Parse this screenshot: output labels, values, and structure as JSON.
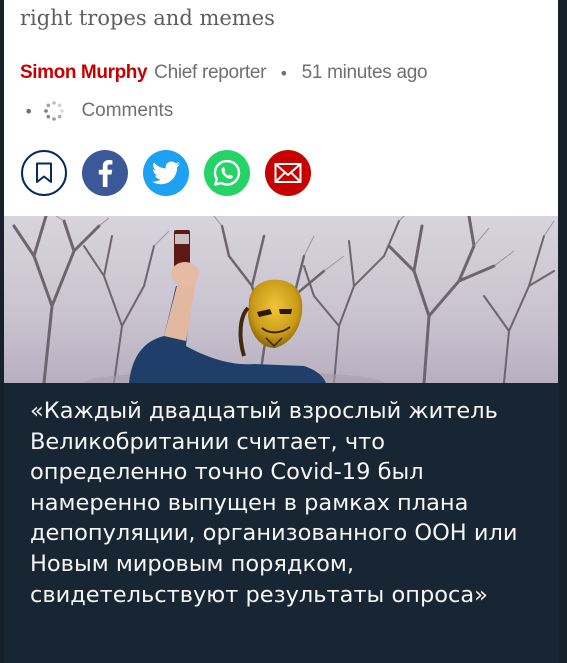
{
  "article": {
    "headline_tail": "right tropes and memes",
    "author": "Simon Murphy",
    "role": "Chief reporter",
    "time": "51 minutes ago",
    "comments_label": "Comments"
  },
  "share_icons": [
    "bookmark-icon",
    "facebook-icon",
    "twitter-icon",
    "whatsapp-icon",
    "email-icon"
  ],
  "colors": {
    "brand_red": "#c70000",
    "facebook": "#3b5998",
    "twitter": "#1da1f2",
    "whatsapp": "#25d366",
    "bookmark_border": "#052962",
    "chat_background": "#182533"
  },
  "message": {
    "text": "«Каждый двадцатый взрослый житель Великобритании считает, что определенно точно Covid-19 был намеренно выпущен в рамках плана депопуляции, организованного ООН или Новым мировым порядком, свидетельствуют результаты опроса»"
  }
}
